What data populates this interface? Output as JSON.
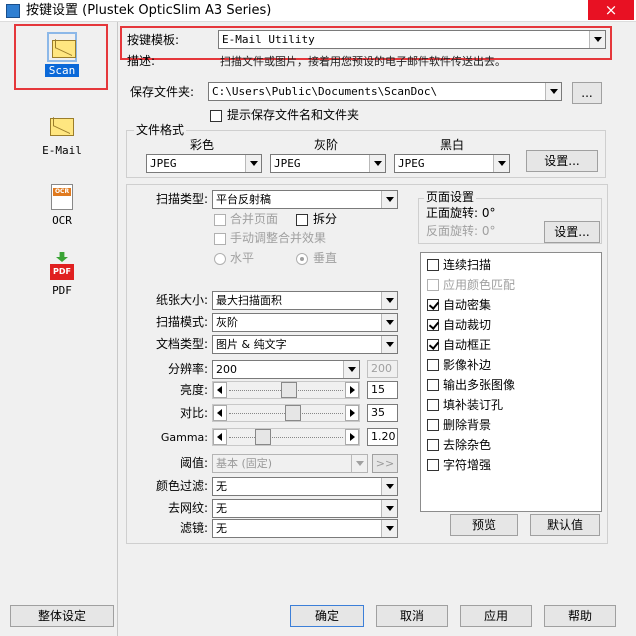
{
  "window": {
    "title": "按键设置 (Plustek OpticSlim A3 Series)",
    "close_glyph": "×"
  },
  "nav": [
    {
      "label": "Scan",
      "icon": "scan-envelope-icon",
      "selected": true
    },
    {
      "label": "E-Mail",
      "icon": "email-envelope-icon",
      "selected": false
    },
    {
      "label": "OCR",
      "icon": "ocr-document-icon",
      "selected": false
    },
    {
      "label": "PDF",
      "icon": "pdf-document-icon",
      "selected": false
    }
  ],
  "icon_text": {
    "ocr": "OCR",
    "pdf": "PDF"
  },
  "template": {
    "label": "按键模板:",
    "value": "E-Mail Utility"
  },
  "description": {
    "label": "描述:",
    "text": "扫描文件或图片，接着用您预设的电子邮件软件传送出去。"
  },
  "save_folder": {
    "label": "保存文件夹:",
    "value": "C:\\Users\\Public\\Documents\\ScanDoc\\",
    "browse_label": "...",
    "prompt_label": "提示保存文件名和文件夹",
    "prompt_checked": false
  },
  "file_format": {
    "title": "文件格式",
    "color_label": "彩色",
    "gray_label": "灰阶",
    "bw_label": "黑白",
    "color_value": "JPEG",
    "gray_value": "JPEG",
    "bw_value": "JPEG",
    "settings_label": "设置..."
  },
  "scan": {
    "scan_type_label": "扫描类型:",
    "scan_type_value": "平台反射稿",
    "merge_pages_label": "合并页面",
    "split_label": "拆分",
    "manual_merge_label": "手动调整合并效果",
    "horizontal_label": "水平",
    "vertical_label": "垂直",
    "paper_size_label": "纸张大小:",
    "paper_size_value": "最大扫描面积",
    "scan_mode_label": "扫描模式:",
    "scan_mode_value": "灰阶",
    "doc_type_label": "文档类型:",
    "doc_type_value": "图片 & 纯文字",
    "resolution_label": "分辨率:",
    "resolution_value": "200",
    "resolution_secondary": "200",
    "brightness_label": "亮度:",
    "brightness_value": "15",
    "brightness_fraction": 0.53,
    "contrast_label": "对比:",
    "contrast_value": "35",
    "contrast_fraction": 0.57,
    "gamma_label": "Gamma:",
    "gamma_value": "1.20",
    "gamma_fraction": 0.27,
    "threshold_label": "阈值:",
    "threshold_value": "基本 (固定)",
    "threshold_btn": ">>",
    "color_filter_label": "颜色过滤:",
    "color_filter_value": "无",
    "descreen_label": "去网纹:",
    "descreen_value": "无",
    "filter_label": "滤镜:",
    "filter_value": "无"
  },
  "page_settings": {
    "title": "页面设置",
    "front_label": "正面旋转: 0°",
    "back_label": "反面旋转: 0°",
    "settings_label": "设置..."
  },
  "options": [
    {
      "label": "连续扫描",
      "checked": false,
      "enabled": true
    },
    {
      "label": "应用颜色匹配",
      "checked": false,
      "enabled": false
    },
    {
      "label": "自动密集",
      "checked": true,
      "enabled": true
    },
    {
      "label": "自动裁切",
      "checked": true,
      "enabled": true
    },
    {
      "label": "自动框正",
      "checked": true,
      "enabled": true
    },
    {
      "label": "影像补边",
      "checked": false,
      "enabled": true
    },
    {
      "label": "输出多张图像",
      "checked": false,
      "enabled": true
    },
    {
      "label": "填补装订孔",
      "checked": false,
      "enabled": true
    },
    {
      "label": "删除背景",
      "checked": false,
      "enabled": true
    },
    {
      "label": "去除杂色",
      "checked": false,
      "enabled": true
    },
    {
      "label": "字符增强",
      "checked": false,
      "enabled": true
    }
  ],
  "actions": {
    "preview": "预览",
    "default": "默认值",
    "global_settings": "整体设定",
    "ok": "确定",
    "cancel": "取消",
    "apply": "应用",
    "help": "帮助"
  },
  "colors": {
    "highlight": "#e5373b",
    "selection": "#0a68d8",
    "close": "#e81123"
  }
}
